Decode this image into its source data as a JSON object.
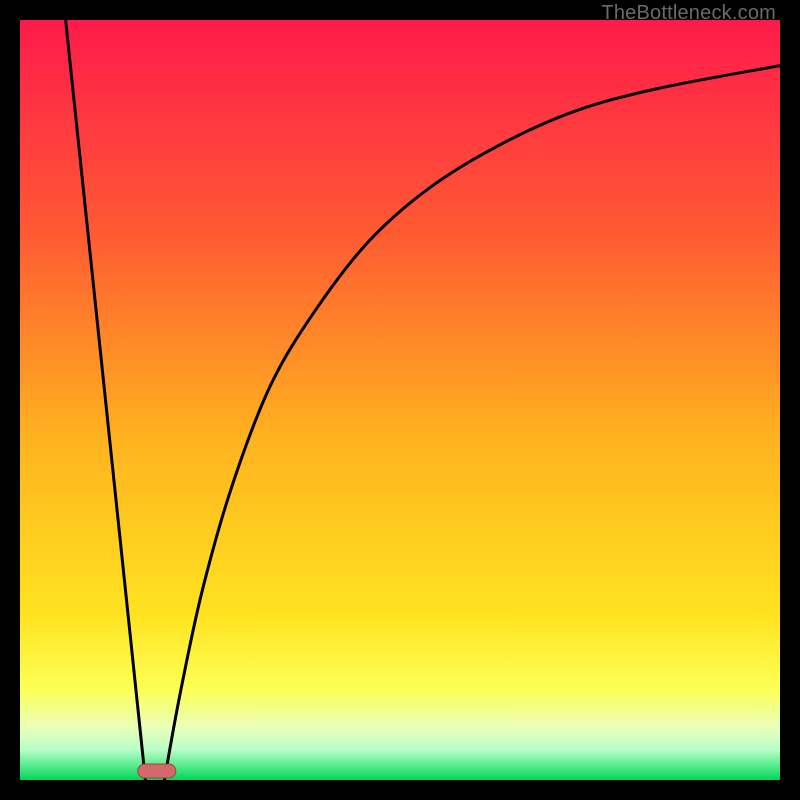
{
  "attribution": "TheBottleneck.com",
  "colors": {
    "bg": "#000000",
    "gradient_top": "#ff1a4b",
    "gradient_mid1": "#ff6a2a",
    "gradient_mid2": "#ffd21f",
    "gradient_low1": "#fbff3a",
    "gradient_low2": "#d8ffb0",
    "gradient_bottom": "#00e05a",
    "curve": "#000000",
    "marker_fill": "#d36a6a",
    "marker_stroke": "#a33f3f"
  },
  "chart_data": {
    "type": "line",
    "title": "",
    "xlabel": "",
    "ylabel": "",
    "xlim": [
      0,
      100
    ],
    "ylim": [
      0,
      100
    ],
    "series": [
      {
        "name": "left-branch",
        "x": [
          6,
          16.5
        ],
        "y": [
          100,
          0
        ]
      },
      {
        "name": "right-branch",
        "x": [
          19,
          21,
          24,
          28,
          33,
          39,
          46,
          54,
          63,
          73,
          84,
          100
        ],
        "y": [
          0,
          11,
          25,
          39,
          52,
          62,
          71,
          78,
          83.5,
          88,
          91,
          94
        ]
      }
    ],
    "marker": {
      "x_center": 18,
      "y": 0.5,
      "width": 5,
      "height": 2
    },
    "annotations": []
  }
}
